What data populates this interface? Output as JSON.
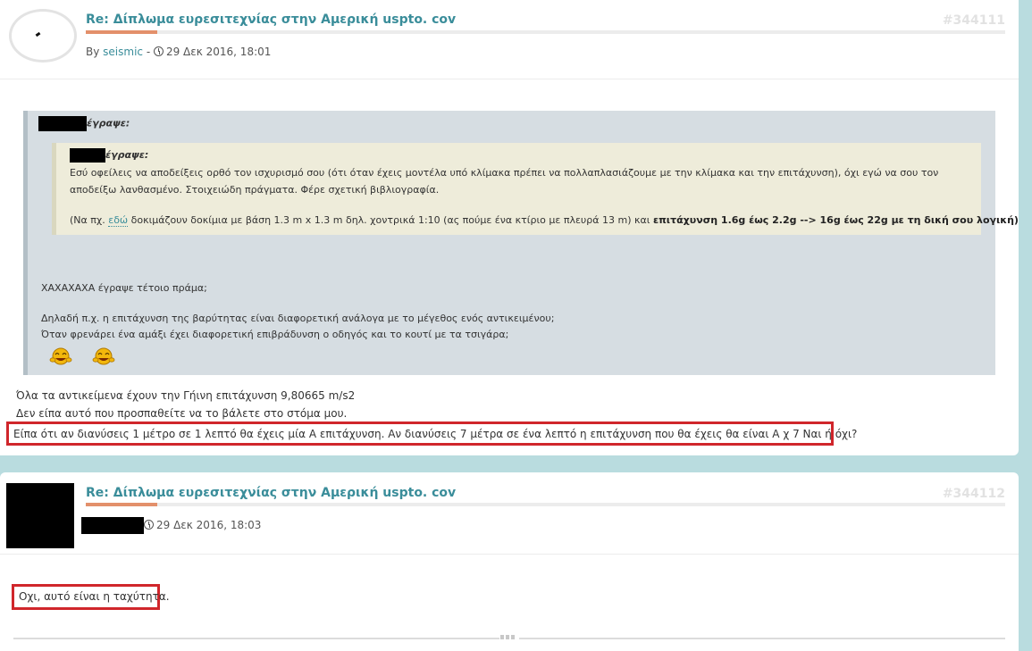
{
  "post1": {
    "title": "Re: Δίπλωμα ευρεσιτεχνίας στην Αμερική uspto. cov",
    "id": "#344111",
    "by_label": "By ",
    "author": "seismic",
    "sep": " - ",
    "date": "29 Δεκ 2016, 18:01",
    "quote": {
      "outer_wrote": "έγραψε:",
      "inner_wrote": "έγραψε:",
      "inner_text": "Εσύ οφείλεις να αποδείξεις ορθό τον ισχυρισμό σου (ότι όταν έχεις μοντέλα υπό κλίμακα πρέπει να πολλαπλασιάζουμε με την κλίμακα και την επιτάχυνση), όχι εγώ να σου τον αποδείξω λανθασμένο. Στοιχειώδη πράγματα. Φέρε σχετική βιβλιογραφία.",
      "inner_ref_pre": "(Να πχ. ",
      "inner_ref_link": "εδώ",
      "inner_ref_mid": " δοκιμάζουν δοκίμια με βάση 1.3 m x 1.3 m δηλ. χοντρικά 1:10 (ας πούμε ένα κτίριο με πλευρά 13 m) και ",
      "inner_ref_bold": "επιτάχυνση 1.6g έως 2.2g --> 16g έως 22g με τη δική σου λογική)",
      "line1": "ΧΑΧΑΧΑΧΑ έγραψε τέτοιο πράμα;",
      "line2": "Δηλαδή π.χ. η επιτάχυνση της βαρύτητας είναι διαφορετική ανάλογα με το μέγεθος ενός αντικειμένου;",
      "line3": "Όταν φρενάρει ένα αμάξι έχει διαφορετική επιβράδυνση ο οδηγός και το κουτί με τα τσιγάρα;"
    },
    "body": {
      "line1": "Όλα τα αντικείμενα έχουν την Γήινη επιτάχυνση 9,80665 m/s2",
      "line2": "Δεν είπα αυτό που προσπαθείτε να το βάλετε στο στόμα μου.",
      "highlight": "Είπα ότι αν διανύσεις 1 μέτρο σε 1 λεπτό θα έχεις μία Α επιτάχυνση. Αν διανύσεις 7 μέτρα σε ένα λεπτό η επιτάχυνση που θα έχεις θα είναι Α χ 7 Ναι ή όχι?"
    }
  },
  "post2": {
    "title": "Re: Δίπλωμα ευρεσιτεχνίας στην Αμερική uspto. cov",
    "id": "#344112",
    "date": "29 Δεκ 2016, 18:03",
    "body": {
      "highlight": "Οχι, αυτό είναι η ταχύτητα."
    }
  },
  "colors": {
    "page_bg": "#b9dcdf",
    "link": "#3a8d9a",
    "accent_rule": "#e3906b",
    "highlight_border": "#d0262b"
  }
}
